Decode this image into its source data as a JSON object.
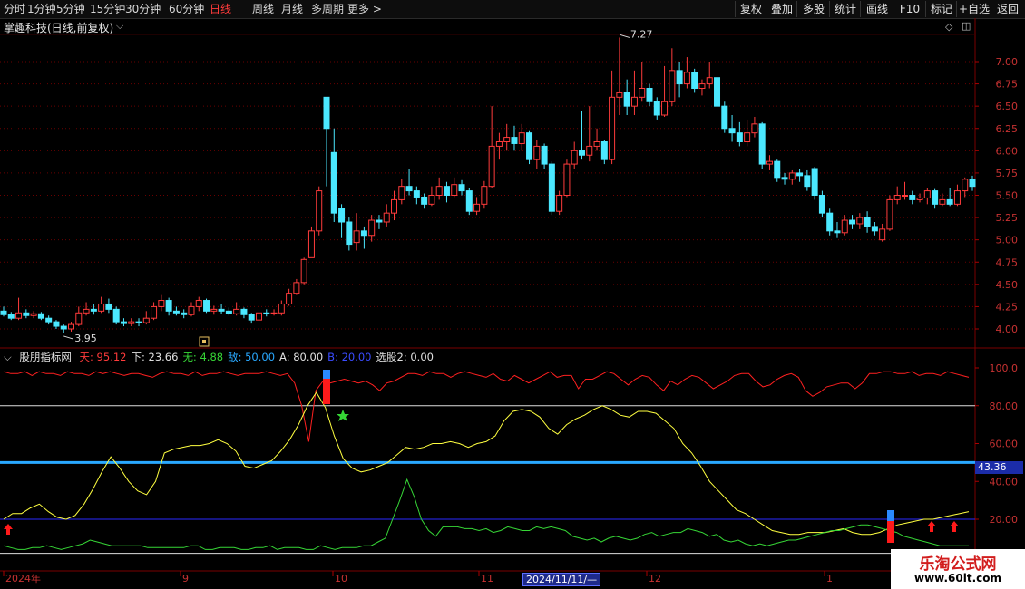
{
  "toolbar": {
    "periods": [
      "分时",
      "1分钟",
      "5分钟",
      "15分钟",
      "30分钟",
      "60分钟",
      "日线",
      "周线",
      "月线",
      "多周期",
      "更多"
    ],
    "active_period": "日线",
    "more_arrow": ">",
    "right_buttons": [
      "复权",
      "叠加",
      "多股",
      "统计",
      "画线",
      "F10",
      "标记",
      "+自选",
      "返回"
    ]
  },
  "stock": {
    "title": "掌趣科技(日线,前复权)",
    "high_label": "7.27",
    "low_label": "3.95"
  },
  "price_axis": [
    "7.00",
    "6.75",
    "6.50",
    "6.25",
    "6.00",
    "5.75",
    "5.50",
    "5.25",
    "5.00",
    "4.75",
    "4.50",
    "4.25",
    "4.00"
  ],
  "indicator": {
    "name": "股朋指标网",
    "legend": [
      {
        "label": "天:",
        "value": "95.12",
        "color": "#ff3b3b"
      },
      {
        "label": "下:",
        "value": "23.66",
        "color": "#e0e0e0"
      },
      {
        "label": "无:",
        "value": "4.88",
        "color": "#36d636"
      },
      {
        "label": "敌:",
        "value": "50.00",
        "color": "#29a8ff"
      },
      {
        "label": "A:",
        "value": "80.00",
        "color": "#e0e0e0"
      },
      {
        "label": "B:",
        "value": "20.00",
        "color": "#3a4cff"
      },
      {
        "label": "选股2:",
        "value": "0.00",
        "color": "#e0e0e0"
      }
    ],
    "axis": [
      "100.0",
      "80.00",
      "60.00",
      "40.00",
      "20.00"
    ],
    "current_value": "43.36"
  },
  "date_axis": {
    "labels": [
      "2024年",
      "9",
      "10",
      "11",
      "12",
      "1"
    ],
    "cursor_date": "2024/11/11/—"
  },
  "watermark": {
    "line1": "乐淘公式网",
    "line2": "www.60lt.com"
  },
  "colors": {
    "up": "#ff3b3b",
    "down": "#4be8ff",
    "grid": "#6a0000",
    "yellow": "#ffff40",
    "green": "#36d636",
    "red": "#ff2020",
    "blue_thick": "#29a8ff",
    "blue_thin": "#2a2aff"
  },
  "chart_data": {
    "type": "candlestick",
    "candles": [
      {
        "o": 4.2,
        "c": 4.16,
        "h": 4.25,
        "l": 4.14
      },
      {
        "o": 4.16,
        "c": 4.12,
        "h": 4.19,
        "l": 4.1
      },
      {
        "o": 4.12,
        "c": 4.18,
        "h": 4.35,
        "l": 4.1
      },
      {
        "o": 4.18,
        "c": 4.15,
        "h": 4.22,
        "l": 4.12
      },
      {
        "o": 4.15,
        "c": 4.17,
        "h": 4.2,
        "l": 4.12
      },
      {
        "o": 4.17,
        "c": 4.12,
        "h": 4.19,
        "l": 4.1
      },
      {
        "o": 4.12,
        "c": 4.08,
        "h": 4.15,
        "l": 4.05
      },
      {
        "o": 4.08,
        "c": 4.03,
        "h": 4.1,
        "l": 4.0
      },
      {
        "o": 4.03,
        "c": 4.0,
        "h": 4.05,
        "l": 3.95
      },
      {
        "o": 4.0,
        "c": 4.05,
        "h": 4.08,
        "l": 3.97
      },
      {
        "o": 4.05,
        "c": 4.18,
        "h": 4.25,
        "l": 4.03
      },
      {
        "o": 4.18,
        "c": 4.22,
        "h": 4.3,
        "l": 4.15
      },
      {
        "o": 4.22,
        "c": 4.2,
        "h": 4.28,
        "l": 4.16
      },
      {
        "o": 4.2,
        "c": 4.28,
        "h": 4.36,
        "l": 4.18
      },
      {
        "o": 4.28,
        "c": 4.22,
        "h": 4.34,
        "l": 4.18
      },
      {
        "o": 4.22,
        "c": 4.08,
        "h": 4.25,
        "l": 4.05
      },
      {
        "o": 4.08,
        "c": 4.06,
        "h": 4.12,
        "l": 4.03
      },
      {
        "o": 4.06,
        "c": 4.08,
        "h": 4.12,
        "l": 4.03
      },
      {
        "o": 4.08,
        "c": 4.07,
        "h": 4.12,
        "l": 4.03
      },
      {
        "o": 4.07,
        "c": 4.12,
        "h": 4.2,
        "l": 4.05
      },
      {
        "o": 4.12,
        "c": 4.25,
        "h": 4.3,
        "l": 4.1
      },
      {
        "o": 4.25,
        "c": 4.32,
        "h": 4.38,
        "l": 4.2
      },
      {
        "o": 4.32,
        "c": 4.2,
        "h": 4.35,
        "l": 4.15
      },
      {
        "o": 4.2,
        "c": 4.18,
        "h": 4.25,
        "l": 4.15
      },
      {
        "o": 4.18,
        "c": 4.16,
        "h": 4.22,
        "l": 4.12
      },
      {
        "o": 4.16,
        "c": 4.25,
        "h": 4.3,
        "l": 4.14
      },
      {
        "o": 4.25,
        "c": 4.32,
        "h": 4.36,
        "l": 4.2
      },
      {
        "o": 4.32,
        "c": 4.2,
        "h": 4.34,
        "l": 4.18
      },
      {
        "o": 4.2,
        "c": 4.22,
        "h": 4.26,
        "l": 4.16
      },
      {
        "o": 4.22,
        "c": 4.2,
        "h": 4.28,
        "l": 4.17
      },
      {
        "o": 4.2,
        "c": 4.17,
        "h": 4.24,
        "l": 4.15
      },
      {
        "o": 4.17,
        "c": 4.22,
        "h": 4.3,
        "l": 4.15
      },
      {
        "o": 4.22,
        "c": 4.16,
        "h": 4.24,
        "l": 4.12
      },
      {
        "o": 4.16,
        "c": 4.1,
        "h": 4.18,
        "l": 4.06
      },
      {
        "o": 4.1,
        "c": 4.18,
        "h": 4.2,
        "l": 4.08
      },
      {
        "o": 4.18,
        "c": 4.17,
        "h": 4.22,
        "l": 4.14
      },
      {
        "o": 4.17,
        "c": 4.18,
        "h": 4.22,
        "l": 4.15
      },
      {
        "o": 4.18,
        "c": 4.28,
        "h": 4.32,
        "l": 4.15
      },
      {
        "o": 4.28,
        "c": 4.4,
        "h": 4.45,
        "l": 4.26
      },
      {
        "o": 4.4,
        "c": 4.52,
        "h": 4.56,
        "l": 4.38
      },
      {
        "o": 4.52,
        "c": 4.78,
        "h": 4.8,
        "l": 4.5
      },
      {
        "o": 4.8,
        "c": 5.1,
        "h": 5.15,
        "l": 4.88
      },
      {
        "o": 5.1,
        "c": 5.55,
        "h": 5.6,
        "l": 5.05
      },
      {
        "o": 6.6,
        "c": 6.25,
        "h": 6.6,
        "l": 5.6
      },
      {
        "o": 5.98,
        "c": 5.3,
        "h": 6.25,
        "l": 5.2
      },
      {
        "o": 5.35,
        "c": 5.2,
        "h": 5.4,
        "l": 5.02
      },
      {
        "o": 5.2,
        "c": 4.95,
        "h": 5.25,
        "l": 4.88
      },
      {
        "o": 4.97,
        "c": 5.1,
        "h": 5.3,
        "l": 4.88
      },
      {
        "o": 5.1,
        "c": 5.05,
        "h": 5.15,
        "l": 4.9
      },
      {
        "o": 5.05,
        "c": 5.22,
        "h": 5.28,
        "l": 4.98
      },
      {
        "o": 5.22,
        "c": 5.2,
        "h": 5.28,
        "l": 5.12
      },
      {
        "o": 5.2,
        "c": 5.3,
        "h": 5.4,
        "l": 5.15
      },
      {
        "o": 5.3,
        "c": 5.45,
        "h": 5.55,
        "l": 5.22
      },
      {
        "o": 5.45,
        "c": 5.6,
        "h": 5.68,
        "l": 5.4
      },
      {
        "o": 5.6,
        "c": 5.55,
        "h": 5.8,
        "l": 5.5
      },
      {
        "o": 5.55,
        "c": 5.48,
        "h": 5.6,
        "l": 5.4
      },
      {
        "o": 5.48,
        "c": 5.4,
        "h": 5.52,
        "l": 5.35
      },
      {
        "o": 5.4,
        "c": 5.5,
        "h": 5.6,
        "l": 5.38
      },
      {
        "o": 5.5,
        "c": 5.6,
        "h": 5.7,
        "l": 5.45
      },
      {
        "o": 5.6,
        "c": 5.5,
        "h": 5.65,
        "l": 5.42
      },
      {
        "o": 5.5,
        "c": 5.62,
        "h": 5.7,
        "l": 5.48
      },
      {
        "o": 5.62,
        "c": 5.55,
        "h": 5.67,
        "l": 5.5
      },
      {
        "o": 5.55,
        "c": 5.32,
        "h": 5.58,
        "l": 5.28
      },
      {
        "o": 5.32,
        "c": 5.4,
        "h": 5.48,
        "l": 5.28
      },
      {
        "o": 5.4,
        "c": 5.6,
        "h": 5.66,
        "l": 5.35
      },
      {
        "o": 5.6,
        "c": 6.05,
        "h": 6.5,
        "l": 5.58
      },
      {
        "o": 6.05,
        "c": 6.1,
        "h": 6.2,
        "l": 5.9
      },
      {
        "o": 6.1,
        "c": 6.15,
        "h": 6.3,
        "l": 6.0
      },
      {
        "o": 6.15,
        "c": 6.08,
        "h": 6.28,
        "l": 6.0
      },
      {
        "o": 6.08,
        "c": 6.2,
        "h": 6.3,
        "l": 6.0
      },
      {
        "o": 6.2,
        "c": 5.9,
        "h": 6.22,
        "l": 5.85
      },
      {
        "o": 5.9,
        "c": 6.05,
        "h": 6.12,
        "l": 5.8
      },
      {
        "o": 6.05,
        "c": 5.85,
        "h": 6.08,
        "l": 5.8
      },
      {
        "o": 5.85,
        "c": 5.32,
        "h": 5.88,
        "l": 5.28
      },
      {
        "o": 5.32,
        "c": 5.5,
        "h": 5.55,
        "l": 5.28
      },
      {
        "o": 5.5,
        "c": 5.85,
        "h": 5.9,
        "l": 5.48
      },
      {
        "o": 5.85,
        "c": 6.0,
        "h": 6.1,
        "l": 5.8
      },
      {
        "o": 6.0,
        "c": 5.95,
        "h": 6.45,
        "l": 5.9
      },
      {
        "o": 5.95,
        "c": 6.05,
        "h": 6.5,
        "l": 5.88
      },
      {
        "o": 6.05,
        "c": 6.1,
        "h": 6.25,
        "l": 6.0
      },
      {
        "o": 6.1,
        "c": 5.9,
        "h": 6.12,
        "l": 5.85
      },
      {
        "o": 5.9,
        "c": 6.6,
        "h": 6.9,
        "l": 5.85
      },
      {
        "o": 6.6,
        "c": 6.65,
        "h": 7.27,
        "l": 6.4
      },
      {
        "o": 6.65,
        "c": 6.5,
        "h": 6.8,
        "l": 6.4
      },
      {
        "o": 6.5,
        "c": 6.6,
        "h": 6.9,
        "l": 6.4
      },
      {
        "o": 6.6,
        "c": 6.7,
        "h": 7.0,
        "l": 6.55
      },
      {
        "o": 6.7,
        "c": 6.55,
        "h": 6.75,
        "l": 6.5
      },
      {
        "o": 6.55,
        "c": 6.4,
        "h": 6.6,
        "l": 6.35
      },
      {
        "o": 6.4,
        "c": 6.55,
        "h": 6.95,
        "l": 6.38
      },
      {
        "o": 6.55,
        "c": 6.9,
        "h": 7.15,
        "l": 6.5
      },
      {
        "o": 6.9,
        "c": 6.75,
        "h": 7.0,
        "l": 6.6
      },
      {
        "o": 6.75,
        "c": 6.88,
        "h": 7.05,
        "l": 6.7
      },
      {
        "o": 6.88,
        "c": 6.7,
        "h": 6.92,
        "l": 6.65
      },
      {
        "o": 6.7,
        "c": 6.75,
        "h": 6.8,
        "l": 6.62
      },
      {
        "o": 6.75,
        "c": 6.82,
        "h": 7.0,
        "l": 6.7
      },
      {
        "o": 6.82,
        "c": 6.5,
        "h": 6.85,
        "l": 6.45
      },
      {
        "o": 6.5,
        "c": 6.25,
        "h": 6.55,
        "l": 6.2
      },
      {
        "o": 6.25,
        "c": 6.2,
        "h": 6.4,
        "l": 6.1
      },
      {
        "o": 6.2,
        "c": 6.1,
        "h": 6.32,
        "l": 6.05
      },
      {
        "o": 6.1,
        "c": 6.2,
        "h": 6.35,
        "l": 6.05
      },
      {
        "o": 6.2,
        "c": 6.3,
        "h": 6.38,
        "l": 6.15
      },
      {
        "o": 6.3,
        "c": 5.85,
        "h": 6.32,
        "l": 5.8
      },
      {
        "o": 5.85,
        "c": 5.88,
        "h": 5.95,
        "l": 5.78
      },
      {
        "o": 5.88,
        "c": 5.7,
        "h": 5.9,
        "l": 5.65
      },
      {
        "o": 5.7,
        "c": 5.68,
        "h": 5.75,
        "l": 5.62
      },
      {
        "o": 5.68,
        "c": 5.75,
        "h": 5.78,
        "l": 5.62
      },
      {
        "o": 5.75,
        "c": 5.72,
        "h": 5.8,
        "l": 5.65
      },
      {
        "o": 5.72,
        "c": 5.6,
        "h": 5.78,
        "l": 5.55
      },
      {
        "o": 5.8,
        "c": 5.5,
        "h": 5.82,
        "l": 5.45
      },
      {
        "o": 5.5,
        "c": 5.3,
        "h": 5.55,
        "l": 5.25
      },
      {
        "o": 5.3,
        "c": 5.1,
        "h": 5.35,
        "l": 5.05
      },
      {
        "o": 5.1,
        "c": 5.08,
        "h": 5.2,
        "l": 5.02
      },
      {
        "o": 5.08,
        "c": 5.22,
        "h": 5.28,
        "l": 5.05
      },
      {
        "o": 5.22,
        "c": 5.18,
        "h": 5.28,
        "l": 5.12
      },
      {
        "o": 5.18,
        "c": 5.25,
        "h": 5.3,
        "l": 5.12
      },
      {
        "o": 5.25,
        "c": 5.15,
        "h": 5.32,
        "l": 5.08
      },
      {
        "o": 5.15,
        "c": 5.1,
        "h": 5.2,
        "l": 5.05
      },
      {
        "o": 5.0,
        "c": 5.12,
        "h": 5.18,
        "l": 4.98
      },
      {
        "o": 5.12,
        "c": 5.45,
        "h": 5.5,
        "l": 5.1
      },
      {
        "o": 5.45,
        "c": 5.5,
        "h": 5.6,
        "l": 5.4
      },
      {
        "o": 5.5,
        "c": 5.5,
        "h": 5.65,
        "l": 5.45
      },
      {
        "o": 5.5,
        "c": 5.45,
        "h": 5.55,
        "l": 5.4
      },
      {
        "o": 5.45,
        "c": 5.47,
        "h": 5.52,
        "l": 5.42
      },
      {
        "o": 5.47,
        "c": 5.55,
        "h": 5.58,
        "l": 5.4
      },
      {
        "o": 5.55,
        "c": 5.4,
        "h": 5.57,
        "l": 5.35
      },
      {
        "o": 5.4,
        "c": 5.45,
        "h": 5.52,
        "l": 5.38
      },
      {
        "o": 5.45,
        "c": 5.4,
        "h": 5.58,
        "l": 5.38
      },
      {
        "o": 5.4,
        "c": 5.55,
        "h": 5.62,
        "l": 5.38
      },
      {
        "o": 5.55,
        "c": 5.68,
        "h": 5.7,
        "l": 5.48
      },
      {
        "o": 5.68,
        "c": 5.6,
        "h": 5.72,
        "l": 5.55
      }
    ],
    "series": [
      {
        "name": "天",
        "values": [
          98,
          97,
          97,
          98,
          96,
          98,
          97,
          97,
          96,
          98,
          97,
          97,
          96,
          98,
          97,
          98,
          97,
          96,
          97,
          97,
          96,
          95,
          97,
          98,
          97,
          97,
          96,
          98,
          96,
          97,
          97,
          98,
          97,
          96,
          97,
          97,
          97,
          98,
          97,
          96,
          97,
          92,
          80,
          61,
          88,
          93,
          92,
          93,
          94,
          93,
          92,
          93,
          91,
          88,
          92,
          93,
          95,
          97,
          97,
          96,
          98,
          97,
          97,
          95,
          97,
          98,
          97,
          96,
          95,
          97,
          94,
          93,
          96,
          94,
          92,
          94,
          96,
          98,
          95,
          96,
          96,
          89,
          94,
          94,
          96,
          98,
          97,
          94,
          91,
          94,
          96,
          95,
          91,
          88,
          93,
          91,
          94,
          96,
          95,
          92,
          89,
          91,
          93,
          96,
          97,
          97,
          93,
          90,
          91,
          94,
          96,
          97,
          95,
          88,
          85,
          87,
          90,
          91,
          92,
          92,
          89,
          92,
          97,
          97,
          98,
          98,
          97,
          97,
          98,
          96,
          97,
          97,
          96,
          98,
          97,
          96,
          95
        ]
      },
      {
        "name": "下",
        "values": [
          20,
          23,
          23,
          26,
          28,
          24,
          21,
          20,
          22,
          28,
          36,
          45,
          53,
          47,
          40,
          35,
          33,
          40,
          55,
          57,
          58,
          59,
          59,
          60,
          62,
          60,
          56,
          48,
          47,
          49,
          51,
          56,
          62,
          70,
          80,
          87,
          79,
          64,
          52,
          47,
          45,
          46,
          48,
          50,
          54,
          58,
          57,
          58,
          60,
          60,
          61,
          60,
          58,
          60,
          61,
          64,
          72,
          77,
          78,
          77,
          74,
          68,
          65,
          70,
          73,
          75,
          78,
          80,
          78,
          75,
          74,
          77,
          77,
          76,
          72,
          68,
          60,
          55,
          48,
          40,
          35,
          30,
          25,
          23,
          20,
          17,
          14,
          13,
          12,
          12,
          13,
          13,
          13,
          14,
          15,
          13,
          12,
          12,
          13,
          15,
          17,
          18,
          19,
          20,
          20,
          21,
          22,
          23,
          24
        ]
      },
      {
        "name": "无",
        "values": [
          6,
          5,
          4,
          4,
          5,
          5,
          6,
          5,
          4,
          5,
          6,
          7,
          9,
          8,
          7,
          6,
          6,
          6,
          6,
          6,
          5,
          5,
          5,
          5,
          5,
          5,
          6,
          6,
          4,
          4,
          5,
          5,
          5,
          4,
          4,
          5,
          5,
          6,
          4,
          5,
          5,
          5,
          4,
          4,
          6,
          5,
          4,
          5,
          5,
          5,
          6,
          6,
          8,
          10,
          20,
          30,
          41,
          32,
          20,
          14,
          11,
          16,
          16,
          16,
          15,
          15,
          14,
          15,
          13,
          14,
          16,
          15,
          14,
          14,
          16,
          15,
          16,
          15,
          14,
          11,
          10,
          9,
          10,
          8,
          10,
          11,
          10,
          9,
          10,
          12,
          13,
          11,
          12,
          13,
          13,
          15,
          14,
          13,
          11,
          12,
          9,
          8,
          9,
          7,
          6,
          7,
          6,
          7,
          8,
          9,
          9,
          10,
          11,
          12,
          13,
          14,
          14,
          15,
          16,
          17,
          17,
          16,
          15,
          14,
          13,
          11,
          10,
          9,
          8,
          7,
          6,
          6,
          6,
          6,
          6
        ]
      }
    ]
  }
}
